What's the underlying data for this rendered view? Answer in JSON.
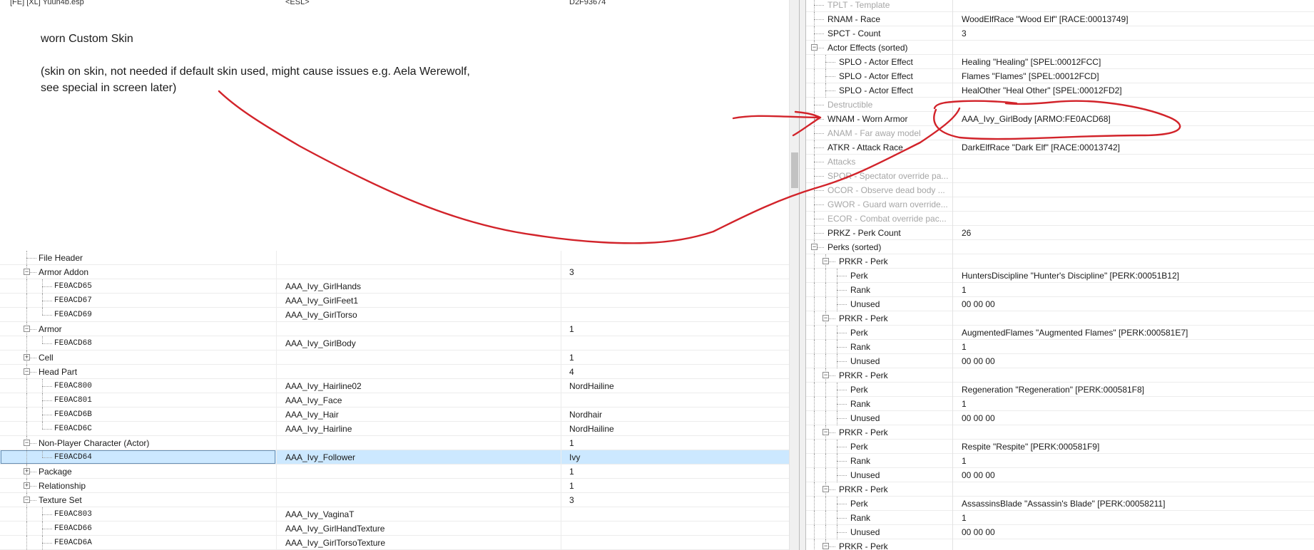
{
  "top_row": {
    "c1": "[FE] [XL] Yuun4b.esp",
    "c2": "<ESL>",
    "c3": "D2F93674"
  },
  "notes": {
    "title": "worn Custom Skin",
    "line1": "(skin on skin, not needed if default skin used, might cause issues e.g. Aela Werewolf,",
    "line2": "see special in screen later)"
  },
  "left_tree": {
    "rows": [
      {
        "c1": "File Header",
        "c2": "",
        "c3": ""
      },
      {
        "c1": "Armor Addon",
        "c2": "",
        "c3": "3"
      },
      {
        "c1": "FE0ACD65",
        "c2": "AAA_Ivy_GirlHands",
        "c3": ""
      },
      {
        "c1": "FE0ACD67",
        "c2": "AAA_Ivy_GirlFeet1",
        "c3": ""
      },
      {
        "c1": "FE0ACD69",
        "c2": "AAA_Ivy_GirlTorso",
        "c3": ""
      },
      {
        "c1": "Armor",
        "c2": "",
        "c3": "1"
      },
      {
        "c1": "FE0ACD68",
        "c2": "AAA_Ivy_GirlBody",
        "c3": ""
      },
      {
        "c1": "Cell",
        "c2": "",
        "c3": "1"
      },
      {
        "c1": "Head Part",
        "c2": "",
        "c3": "4"
      },
      {
        "c1": "FE0AC800",
        "c2": "AAA_Ivy_Hairline02",
        "c3": "NordHailine"
      },
      {
        "c1": "FE0AC801",
        "c2": "AAA_Ivy_Face",
        "c3": ""
      },
      {
        "c1": "FE0ACD6B",
        "c2": "AAA_Ivy_Hair",
        "c3": "Nordhair"
      },
      {
        "c1": "FE0ACD6C",
        "c2": "AAA_Ivy_Hairline",
        "c3": "NordHailine"
      },
      {
        "c1": "Non-Player Character (Actor)",
        "c2": "",
        "c3": "1"
      },
      {
        "c1": "FE0ACD64",
        "c2": "AAA_Ivy_Follower",
        "c3": "Ivy"
      },
      {
        "c1": "Package",
        "c2": "",
        "c3": "1"
      },
      {
        "c1": "Relationship",
        "c2": "",
        "c3": "1"
      },
      {
        "c1": "Texture Set",
        "c2": "",
        "c3": "3"
      },
      {
        "c1": "FE0AC803",
        "c2": "AAA_Ivy_VaginaT",
        "c3": ""
      },
      {
        "c1": "FE0ACD66",
        "c2": "AAA_Ivy_GirlHandTexture",
        "c3": ""
      },
      {
        "c1": "FE0ACD6A",
        "c2": "AAA_Ivy_GirlTorsoTexture",
        "c3": ""
      }
    ]
  },
  "right_tree": {
    "rows": [
      {
        "k": "TPLT - Template",
        "v": ""
      },
      {
        "k": "RNAM - Race",
        "v": "WoodElfRace \"Wood Elf\" [RACE:00013749]"
      },
      {
        "k": "SPCT - Count",
        "v": "3"
      },
      {
        "k": "Actor Effects (sorted)",
        "v": ""
      },
      {
        "k": "SPLO - Actor Effect",
        "v": "Healing \"Healing\" [SPEL:00012FCC]"
      },
      {
        "k": "SPLO - Actor Effect",
        "v": "Flames \"Flames\" [SPEL:00012FCD]"
      },
      {
        "k": "SPLO - Actor Effect",
        "v": "HealOther \"Heal Other\" [SPEL:00012FD2]"
      },
      {
        "k": "Destructible",
        "v": ""
      },
      {
        "k": "WNAM - Worn Armor",
        "v": "AAA_Ivy_GirlBody [ARMO:FE0ACD68]"
      },
      {
        "k": "ANAM - Far away model",
        "v": ""
      },
      {
        "k": "ATKR - Attack Race",
        "v": "DarkElfRace \"Dark Elf\" [RACE:00013742]"
      },
      {
        "k": "Attacks",
        "v": ""
      },
      {
        "k": "SPOR - Spectator override pa...",
        "v": ""
      },
      {
        "k": "OCOR - Observe dead body ...",
        "v": ""
      },
      {
        "k": "GWOR - Guard warn override...",
        "v": ""
      },
      {
        "k": "ECOR - Combat override pac...",
        "v": ""
      },
      {
        "k": "PRKZ - Perk Count",
        "v": "26"
      },
      {
        "k": "Perks (sorted)",
        "v": ""
      },
      {
        "k": "PRKR - Perk",
        "v": ""
      },
      {
        "k": "Perk",
        "v": "HuntersDiscipline \"Hunter's Discipline\" [PERK:00051B12]"
      },
      {
        "k": "Rank",
        "v": "1"
      },
      {
        "k": "Unused",
        "v": "00 00 00"
      },
      {
        "k": "PRKR - Perk",
        "v": ""
      },
      {
        "k": "Perk",
        "v": "AugmentedFlames \"Augmented Flames\" [PERK:000581E7]"
      },
      {
        "k": "Rank",
        "v": "1"
      },
      {
        "k": "Unused",
        "v": "00 00 00"
      },
      {
        "k": "PRKR - Perk",
        "v": ""
      },
      {
        "k": "Perk",
        "v": "Regeneration \"Regeneration\" [PERK:000581F8]"
      },
      {
        "k": "Rank",
        "v": "1"
      },
      {
        "k": "Unused",
        "v": "00 00 00"
      },
      {
        "k": "PRKR - Perk",
        "v": ""
      },
      {
        "k": "Perk",
        "v": "Respite \"Respite\" [PERK:000581F9]"
      },
      {
        "k": "Rank",
        "v": "1"
      },
      {
        "k": "Unused",
        "v": "00 00 00"
      },
      {
        "k": "PRKR - Perk",
        "v": ""
      },
      {
        "k": "Perk",
        "v": "AssassinsBlade \"Assassin's Blade\" [PERK:00058211]"
      },
      {
        "k": "Rank",
        "v": "1"
      },
      {
        "k": "Unused",
        "v": "00 00 00"
      },
      {
        "k": "PRKR - Perk",
        "v": ""
      }
    ]
  },
  "colors": {
    "annotation": "#d2232a",
    "selection": "#cce8ff",
    "dim_text": "#a6a6a6"
  }
}
